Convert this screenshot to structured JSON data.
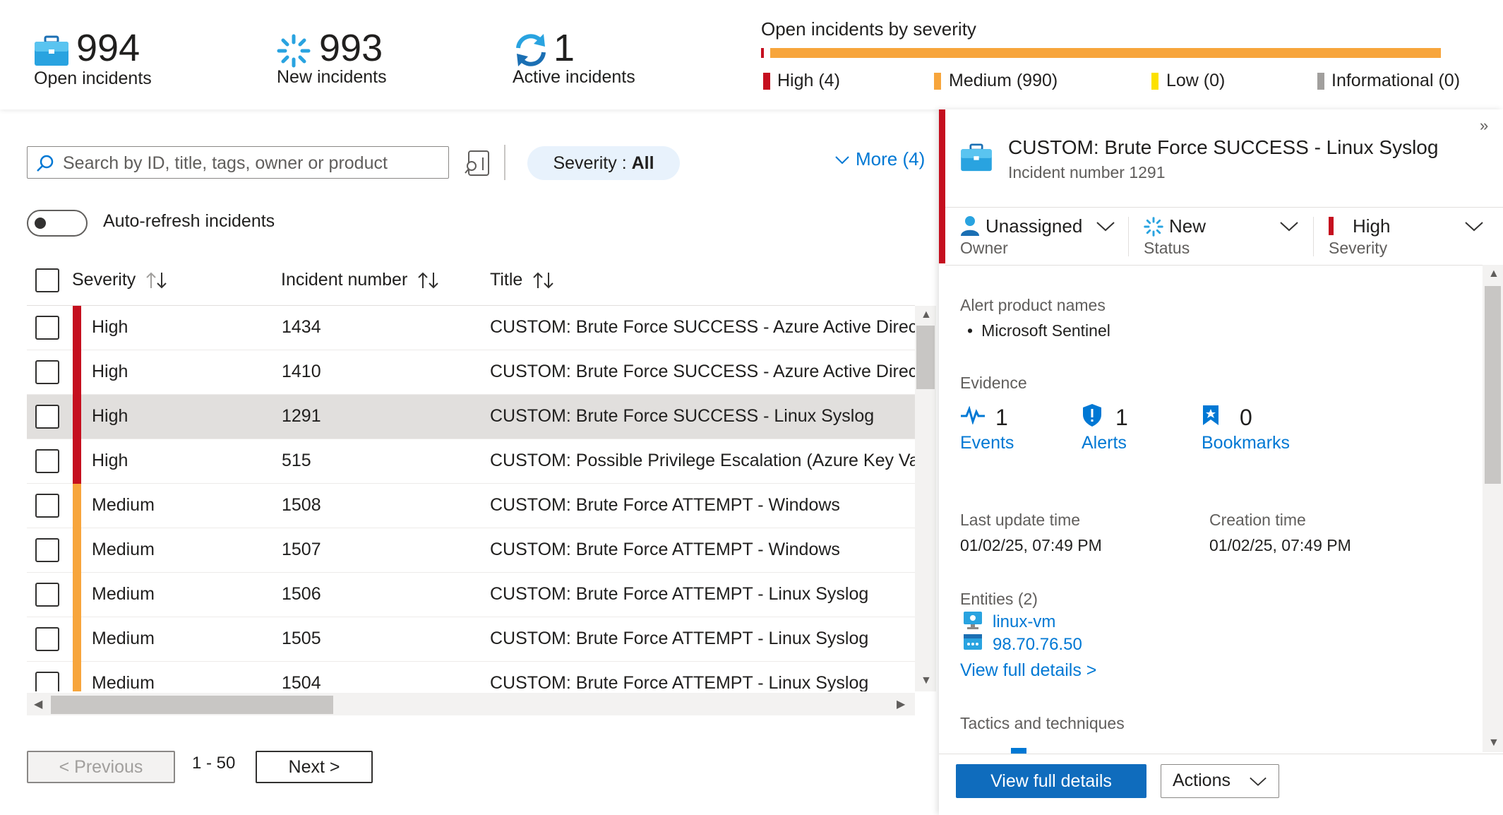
{
  "summary": {
    "open": {
      "count": "994",
      "label": "Open incidents"
    },
    "new": {
      "count": "993",
      "label": "New incidents"
    },
    "active": {
      "count": "1",
      "label": "Active incidents"
    },
    "severity_chart": {
      "title": "Open incidents by severity",
      "legend": [
        {
          "label": "High (4)",
          "color": "#c50f1f"
        },
        {
          "label": "Medium (990)",
          "color": "#f7a53c"
        },
        {
          "label": "Low (0)",
          "color": "#fce100"
        },
        {
          "label": "Informational (0)",
          "color": "#a19f9d"
        }
      ]
    }
  },
  "toolbar": {
    "search_placeholder": "Search by ID, title, tags, owner or product",
    "severity_filter_key": "Severity : ",
    "severity_filter_value": "All",
    "more_label": "More (4)",
    "auto_refresh_label": "Auto-refresh incidents"
  },
  "table": {
    "columns": [
      "Severity",
      "Incident number",
      "Title"
    ],
    "rows": [
      {
        "severity": "High",
        "number": "1434",
        "title": "CUSTOM: Brute Force SUCCESS - Azure Active Direct",
        "color": "#c50f1f"
      },
      {
        "severity": "High",
        "number": "1410",
        "title": "CUSTOM: Brute Force SUCCESS - Azure Active Direct",
        "color": "#c50f1f"
      },
      {
        "severity": "High",
        "number": "1291",
        "title": "CUSTOM: Brute Force SUCCESS - Linux Syslog",
        "color": "#c50f1f"
      },
      {
        "severity": "High",
        "number": "515",
        "title": "CUSTOM: Possible Privilege Escalation (Azure Key Vau",
        "color": "#c50f1f"
      },
      {
        "severity": "Medium",
        "number": "1508",
        "title": "CUSTOM: Brute Force ATTEMPT - Windows",
        "color": "#f7a53c"
      },
      {
        "severity": "Medium",
        "number": "1507",
        "title": "CUSTOM: Brute Force ATTEMPT - Windows",
        "color": "#f7a53c"
      },
      {
        "severity": "Medium",
        "number": "1506",
        "title": "CUSTOM: Brute Force ATTEMPT - Linux Syslog",
        "color": "#f7a53c"
      },
      {
        "severity": "Medium",
        "number": "1505",
        "title": "CUSTOM: Brute Force ATTEMPT - Linux Syslog",
        "color": "#f7a53c"
      },
      {
        "severity": "Medium",
        "number": "1504",
        "title": "CUSTOM: Brute Force ATTEMPT - Linux Syslog",
        "color": "#f7a53c"
      }
    ]
  },
  "pager": {
    "previous": "< Previous",
    "range": "1 - 50",
    "next": "Next >"
  },
  "detail": {
    "title": "CUSTOM: Brute Force SUCCESS - Linux Syslog",
    "subtitle": "Incident number 1291",
    "owner": {
      "value": "Unassigned",
      "label": "Owner"
    },
    "status": {
      "value": "New",
      "label": "Status"
    },
    "severity": {
      "value": "High",
      "label": "Severity"
    },
    "alert_products_label": "Alert product names",
    "alert_product": "Microsoft Sentinel",
    "evidence_label": "Evidence",
    "evidence": {
      "events": {
        "count": "1",
        "label": "Events"
      },
      "alerts": {
        "count": "1",
        "label": "Alerts"
      },
      "bookmarks": {
        "count": "0",
        "label": "Bookmarks"
      }
    },
    "last_update_label": "Last update time",
    "last_update_value": "01/02/25, 07:49 PM",
    "creation_label": "Creation time",
    "creation_value": "01/02/25, 07:49 PM",
    "entities_label": "Entities (2)",
    "entities": [
      "linux-vm",
      "98.70.76.50"
    ],
    "view_full_details_link": "View full details >",
    "tactics_label": "Tactics and techniques",
    "primary_button": "View full details",
    "actions_button": "Actions"
  }
}
